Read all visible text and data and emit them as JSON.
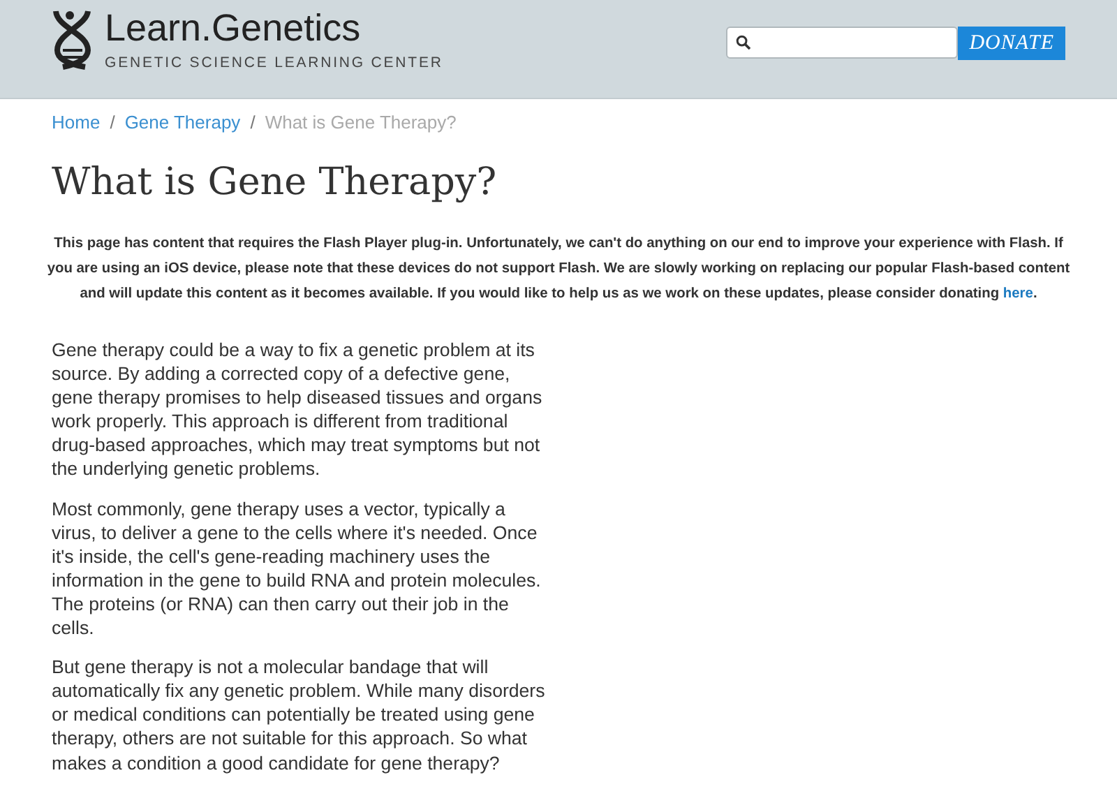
{
  "header": {
    "logo_title": "Learn.Genetics",
    "logo_subtitle": "GENETIC SCIENCE LEARNING CENTER",
    "donate_button": "DONATE"
  },
  "breadcrumb": [
    {
      "label": "Home",
      "current": false
    },
    {
      "label": "Gene Therapy",
      "current": false
    },
    {
      "label": "What is Gene Therapy?",
      "current": true
    }
  ],
  "breadcrumb_separator": "/",
  "title": "What is Gene Therapy?",
  "notice": {
    "text": "This page has content that requires the Flash Player plug-in. Unfortunately, we can't do anything on our end to improve your experience with Flash. If you are using an iOS device, please note that these devices do not support Flash. We are slowly working on replacing our popular Flash-based content and will update this content as it becomes available. If you would like to help us as we work on these updates, please consider donating",
    "link": "here",
    "after": "."
  },
  "paragraphs": [
    "Gene therapy could be a way to fix a genetic problem at its source. By adding a corrected copy of a defective gene, gene therapy promises to help diseased tissues and organs work properly. This approach is different from traditional drug-based approaches, which may treat symptoms but not the underlying genetic problems.",
    "Most commonly, gene therapy uses a vector, typically a virus, to deliver a gene to the cells where it's needed. Once it's inside, the cell's gene-reading machinery uses the information in the gene to build RNA and protein molecules. The proteins (or RNA) can then carry out their job in the cells.",
    "But gene therapy is not a molecular bandage that will automatically fix any genetic problem. While many disorders or medical conditions can potentially be treated using gene therapy, others are not suitable for this approach. So what makes a condition a good candidate for gene therapy?"
  ]
}
